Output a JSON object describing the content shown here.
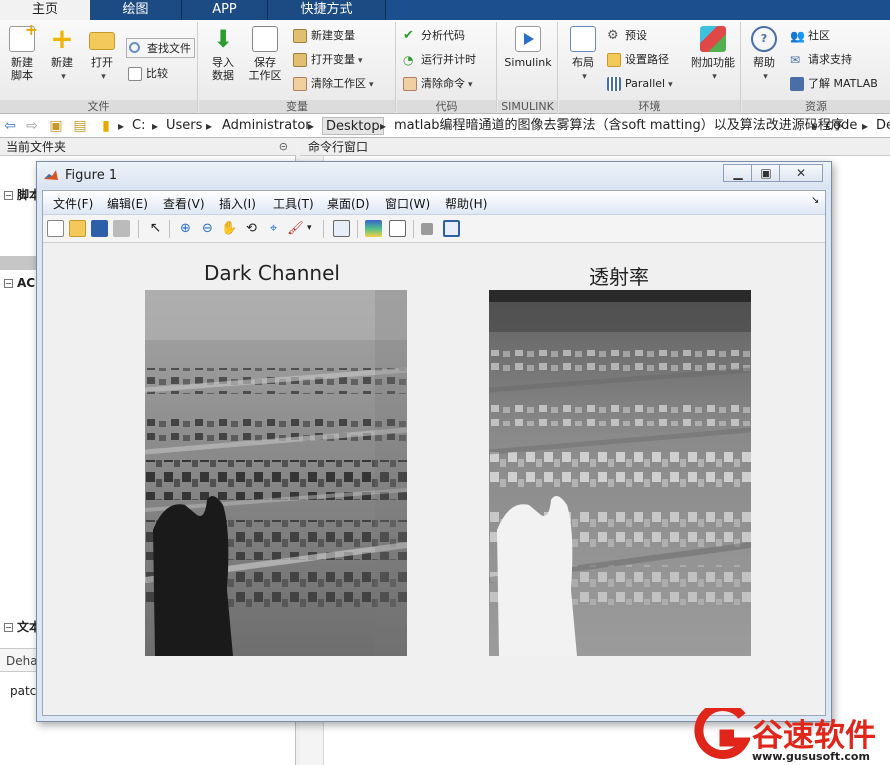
{
  "ribbon_tabs": [
    "主页",
    "绘图",
    "APP",
    "快捷方式"
  ],
  "ribbon": {
    "file": {
      "label": "文件",
      "new_script": "新建\n脚本",
      "new": "新建",
      "open": "打开",
      "find_files": "查找文件",
      "compare": "比较"
    },
    "variable": {
      "label": "变量",
      "import_data": "导入\n数据",
      "save_workspace": "保存\n工作区",
      "new_variable": "新建变量",
      "open_variable": "打开变量",
      "clear_workspace": "清除工作区"
    },
    "code": {
      "label": "代码",
      "analyze_code": "分析代码",
      "run_and_time": "运行并计时",
      "clear_commands": "清除命令"
    },
    "simulink": {
      "label": "SIMULINK",
      "simulink": "Simulink"
    },
    "environment": {
      "label": "环境",
      "layout": "布局",
      "preferences": "预设",
      "set_path": "设置路径",
      "parallel": "Parallel",
      "addons": "附加功能"
    },
    "resources": {
      "label": "资源",
      "help": "帮助",
      "community": "社区",
      "request_support": "请求支持",
      "learn_matlab": "了解 MATLAB"
    }
  },
  "address": {
    "crumbs": [
      "C:",
      "Users",
      "Administrator",
      "Desktop",
      "matlab编程暗通道的图像去雾算法（含soft matting）以及算法改进源码程序",
      "code",
      "De"
    ]
  },
  "left_panel": {
    "title": "当前文件夹",
    "section_script": "脚本",
    "section_ac": "AC",
    "section_text": "文本",
    "item_deha": "Deha",
    "item_patc": "patc"
  },
  "command_window": {
    "title": "命令行窗口"
  },
  "figure": {
    "title": "Figure 1",
    "menus": [
      "文件(F)",
      "编辑(E)",
      "查看(V)",
      "插入(I)",
      "工具(T)",
      "桌面(D)",
      "窗口(W)",
      "帮助(H)"
    ],
    "left_axes_title": "Dark Channel",
    "right_axes_title": "透射率"
  },
  "watermark": {
    "brand": "谷速软件",
    "url": "www.gususoft.com"
  },
  "colors": {
    "tab_bar": "#1b4f8d",
    "figure_frame": "#dde6f3",
    "watermark_red": "#e0261b"
  }
}
